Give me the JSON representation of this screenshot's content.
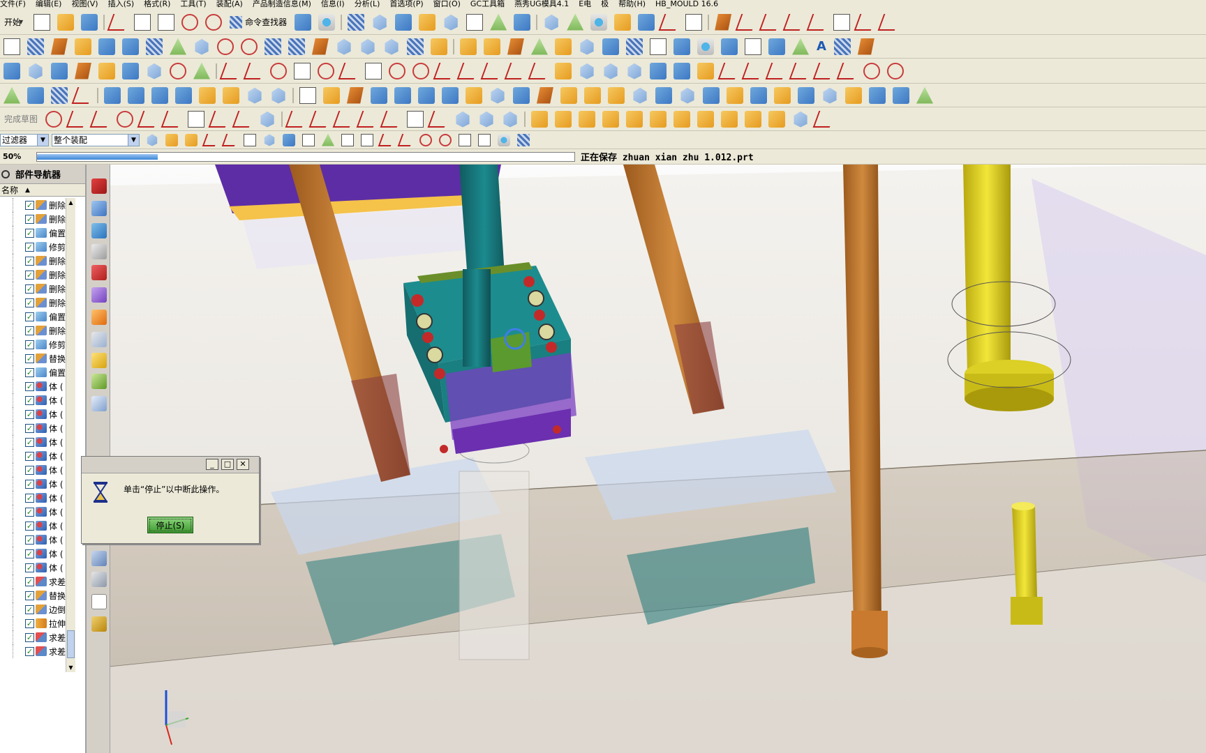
{
  "menu": {
    "items": [
      "文件(F)",
      "编辑(E)",
      "视图(V)",
      "插入(S)",
      "格式(R)",
      "工具(T)",
      "装配(A)",
      "产品制造信息(M)",
      "信息(I)",
      "分析(L)",
      "首选项(P)",
      "窗口(O)",
      "GC工具箱",
      "燕秀UG模具4.1",
      "E电",
      "极",
      "帮助(H)",
      "HB_MOULD 16.6"
    ]
  },
  "toolbar": {
    "start_label": "开始",
    "command_finder_label": "命令查找器",
    "text_tool_label": "A",
    "sketch_label": "完成草图"
  },
  "filter": {
    "type_filter_value": "过滤器",
    "scope_value": "整个装配"
  },
  "progress": {
    "label": "50%",
    "value": 50,
    "status": "正在保存 zhuan xian zhu 1.012.prt"
  },
  "navigator": {
    "title": "部件导航器",
    "column_header": "名称",
    "items": [
      {
        "label": "删除面",
        "icon": "blend"
      },
      {
        "label": "删除面",
        "icon": "blend"
      },
      {
        "label": "偏置面",
        "icon": "offset"
      },
      {
        "label": "修剪体",
        "icon": "offset"
      },
      {
        "label": "删除面",
        "icon": "blend"
      },
      {
        "label": "删除面",
        "icon": "blend"
      },
      {
        "label": "删除面",
        "icon": "blend"
      },
      {
        "label": "删除面",
        "icon": "blend"
      },
      {
        "label": "偏置面",
        "icon": "offset"
      },
      {
        "label": "删除面",
        "icon": "blend"
      },
      {
        "label": "修剪体",
        "icon": "offset"
      },
      {
        "label": "替换面",
        "icon": "blend"
      },
      {
        "label": "偏置面",
        "icon": "offset"
      },
      {
        "label": "体 (",
        "icon": "body"
      },
      {
        "label": "体 (",
        "icon": "body"
      },
      {
        "label": "体 (",
        "icon": "body"
      },
      {
        "label": "体 (",
        "icon": "body"
      },
      {
        "label": "体 (",
        "icon": "body"
      },
      {
        "label": "体 (",
        "icon": "body"
      },
      {
        "label": "体 (",
        "icon": "body"
      },
      {
        "label": "体 (",
        "icon": "body"
      },
      {
        "label": "体 (",
        "icon": "body"
      },
      {
        "label": "体 (",
        "icon": "body"
      },
      {
        "label": "体 (",
        "icon": "body"
      },
      {
        "label": "体 (",
        "icon": "body"
      },
      {
        "label": "体 (",
        "icon": "body"
      },
      {
        "label": "体 (",
        "icon": "body"
      },
      {
        "label": "求差",
        "icon": "sub"
      },
      {
        "label": "替换面",
        "icon": "blend"
      },
      {
        "label": "边倒圆",
        "icon": "blend"
      },
      {
        "label": "拉伸",
        "icon": "extrude"
      },
      {
        "label": "求差",
        "icon": "sub"
      },
      {
        "label": "求差",
        "icon": "sub"
      }
    ]
  },
  "dialog": {
    "message": "单击“停止”以中断此操作。",
    "stop_label": "停止(S)",
    "minimize_glyph": "_",
    "maximize_glyph": "□",
    "close_glyph": "✕"
  },
  "viewport": {
    "colors": {
      "plate_teal": "#1f7a7a",
      "insert_purple": "#7a3fc2",
      "pin_orange": "#c97a2e",
      "pin_yellow": "#e6d31c",
      "ghost_blue": "#c9d7ee"
    }
  }
}
